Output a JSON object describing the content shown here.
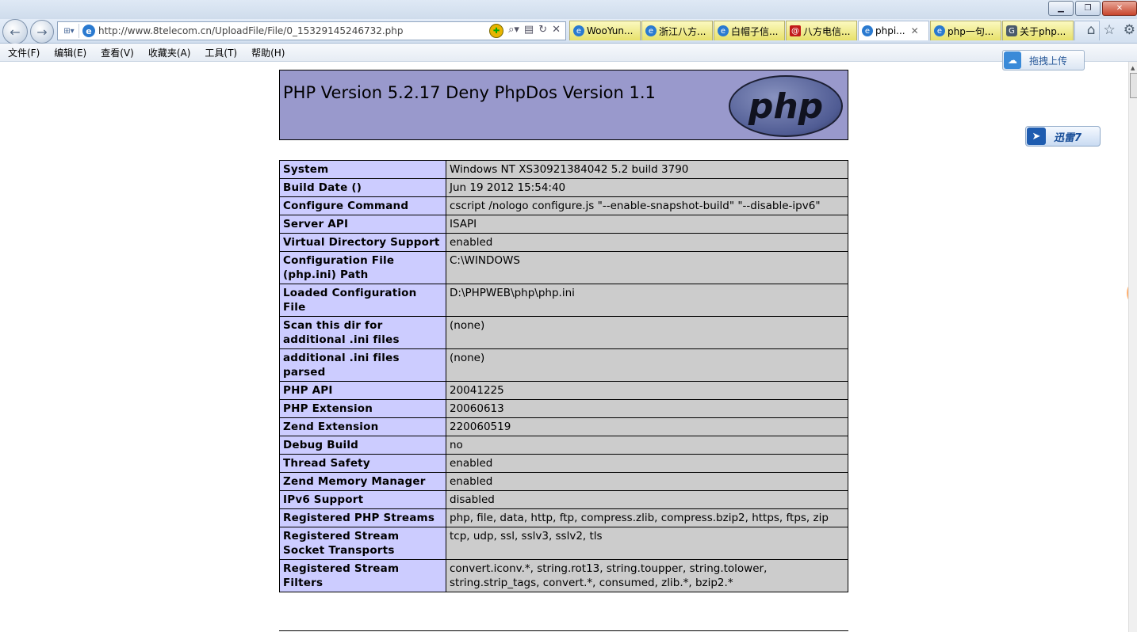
{
  "window": {
    "buttons": [
      "minimize",
      "restore",
      "close"
    ]
  },
  "nav": {
    "back_icon": "back-arrow-icon",
    "forward_icon": "forward-arrow-icon",
    "url": "http://www.8telecom.cn/UploadFile/File/0_15329145246732.php"
  },
  "tabs": [
    {
      "label": "WooYun...",
      "icon": "ie-icon",
      "active": false
    },
    {
      "label": "浙江八方...",
      "icon": "ie-icon",
      "active": false
    },
    {
      "label": "白帽子信...",
      "icon": "ie-icon",
      "active": false
    },
    {
      "label": "八方电信...",
      "icon": "at-icon",
      "active": false
    },
    {
      "label": "phpi...",
      "icon": "ie-icon",
      "active": true
    },
    {
      "label": "php一句...",
      "icon": "ie-icon",
      "active": false
    },
    {
      "label": "关于php...",
      "icon": "g-icon",
      "active": false
    }
  ],
  "menu": [
    "文件(F)",
    "编辑(E)",
    "查看(V)",
    "收藏夹(A)",
    "工具(T)",
    "帮助(H)"
  ],
  "widgets": {
    "upload_label": "拖拽上传",
    "xunlei_label": "迅雷7"
  },
  "php": {
    "header_title": "PHP Version 5.2.17 Deny PhpDos Version 1.1",
    "logo_text": "php",
    "rows": [
      {
        "key": "System",
        "value": "Windows NT XS30921384042 5.2 build 3790"
      },
      {
        "key": "Build Date ()",
        "value": "Jun 19 2012 15:54:40"
      },
      {
        "key": "Configure Command",
        "value": "cscript /nologo configure.js \"--enable-snapshot-build\" \"--disable-ipv6\""
      },
      {
        "key": "Server API",
        "value": "ISAPI"
      },
      {
        "key": "Virtual Directory Support",
        "value": "enabled"
      },
      {
        "key": "Configuration File (php.ini) Path",
        "value": "C:\\WINDOWS"
      },
      {
        "key": "Loaded Configuration File",
        "value": "D:\\PHPWEB\\php\\php.ini"
      },
      {
        "key": "Scan this dir for additional .ini files",
        "value": "(none)"
      },
      {
        "key": "additional .ini files parsed",
        "value": "(none)"
      },
      {
        "key": "PHP API",
        "value": "20041225"
      },
      {
        "key": "PHP Extension",
        "value": "20060613"
      },
      {
        "key": "Zend Extension",
        "value": "220060519"
      },
      {
        "key": "Debug Build",
        "value": "no"
      },
      {
        "key": "Thread Safety",
        "value": "enabled"
      },
      {
        "key": "Zend Memory Manager",
        "value": "enabled"
      },
      {
        "key": "IPv6 Support",
        "value": "disabled"
      },
      {
        "key": "Registered PHP Streams",
        "value": "php, file, data, http, ftp, compress.zlib, compress.bzip2, https, ftps, zip"
      },
      {
        "key": "Registered Stream Socket Transports",
        "value": "tcp, udp, ssl, sslv3, sslv2, tls"
      },
      {
        "key": "Registered Stream Filters",
        "value": "convert.iconv.*, string.rot13, string.toupper, string.tolower, string.strip_tags, convert.*, consumed, zlib.*, bzip2.*"
      }
    ]
  }
}
